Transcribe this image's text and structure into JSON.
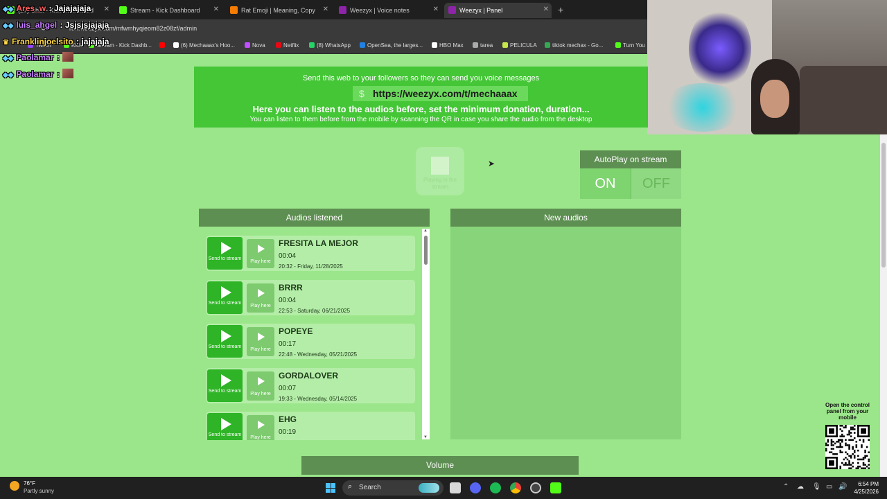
{
  "browser": {
    "tabs": [
      {
        "label": "(27) Chat - Kick Dashboard",
        "color": "#53fc18"
      },
      {
        "label": "Stream - Kick Dashboard",
        "color": "#53fc18"
      },
      {
        "label": "Rat Emoji | Meaning, Copy",
        "color": "#f57c00"
      },
      {
        "label": "Weezyx | Voice notes",
        "color": "#8e24aa"
      },
      {
        "label": "Weezyx | Panel",
        "color": "#8e24aa"
      }
    ],
    "url": "run.weezyx.com/mfwmhyqieom82z08zf/admin",
    "bookmarks": [
      {
        "label": "Twitch",
        "color": "#9146ff"
      },
      {
        "label": "Kick",
        "color": "#53fc18"
      },
      {
        "label": "Stream - Kick Dashb...",
        "color": "#53fc18"
      },
      {
        "label": "",
        "color": "#ff0000"
      },
      {
        "label": "(6) Mechaaax's Hoo...",
        "color": "#ffffff"
      },
      {
        "label": "Nova",
        "color": "#c050ff"
      },
      {
        "label": "Netflix",
        "color": "#e50914"
      },
      {
        "label": "(8) WhatsApp",
        "color": "#25d366"
      },
      {
        "label": "OpenSea, the larges...",
        "color": "#2081e2"
      },
      {
        "label": "HBO Max",
        "color": "#ffffff"
      },
      {
        "label": "tarea",
        "color": "#aaaaaa"
      },
      {
        "label": "PELICULA",
        "color": "#c6e64a"
      },
      {
        "label": "tiktok mechax - Go...",
        "color": "#34a853"
      },
      {
        "label": "Turn You",
        "color": "#53fc18"
      }
    ]
  },
  "chat": [
    {
      "user": "Ares_w",
      "message": ": Jajajajaja",
      "color": "#ff6060",
      "emote": false
    },
    {
      "user": "luis_ahgel",
      "message": ": Jsjsjsjajaja",
      "color": "#c880ff",
      "emote": false
    },
    {
      "user": "Franklinjoelsito",
      "message": ": jajajaja",
      "color": "#ffd84a",
      "emote": false
    },
    {
      "user": "Paolamar",
      "message": ":",
      "color": "#c880ff",
      "emote": true
    },
    {
      "user": "Paolamar",
      "message": ":",
      "color": "#c880ff",
      "emote": true
    }
  ],
  "banner": {
    "line1": "Send this web to your followers so they can send you voice messages",
    "link": "https://weezyx.com/t/mechaaax",
    "dollar": "$",
    "line2": "Here you can listen to the audios before, set the minimum donation, duration...",
    "line3": "You can listen to them before from the mobile by scanning the QR in case you share the audio from the desktop"
  },
  "playing": {
    "label": "Playing in the stream"
  },
  "autoplay": {
    "title": "AutoPlay on stream",
    "on": "ON",
    "off": "OFF"
  },
  "listened": {
    "title": "Audios listened",
    "send_label": "Send to stream",
    "play_label": "Play here",
    "items": [
      {
        "name": "FRESITA LA MEJOR",
        "duration": "00:04",
        "date": "20:32 - Friday, 11/28/2025"
      },
      {
        "name": "BRRR",
        "duration": "00:04",
        "date": "22:53 - Saturday, 06/21/2025"
      },
      {
        "name": "POPEYE",
        "duration": "00:17",
        "date": "22:48 - Wednesday, 05/21/2025"
      },
      {
        "name": "GORDALOVER",
        "duration": "00:07",
        "date": "19:33 - Wednesday, 05/14/2025"
      },
      {
        "name": "EHG",
        "duration": "00:19",
        "date": ""
      }
    ]
  },
  "new_audios": {
    "title": "New audios"
  },
  "volume": {
    "title": "Volume"
  },
  "qr": {
    "text": "Open the control panel from your mobile"
  },
  "taskbar": {
    "temp": "76°F",
    "weather": "Partly sunny",
    "search": "Search",
    "time": "6:54 PM",
    "date": "4/25/2026"
  }
}
